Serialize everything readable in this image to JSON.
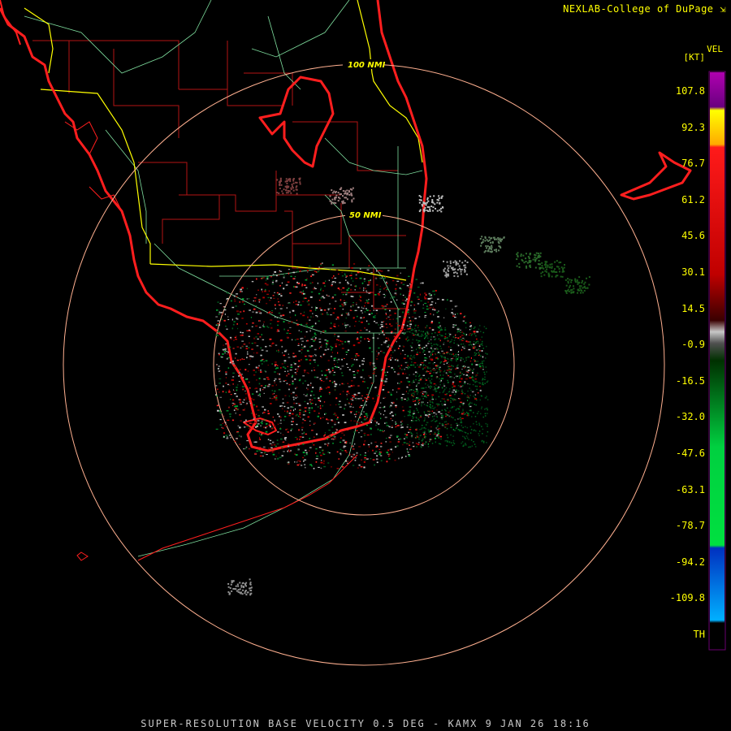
{
  "header": {
    "credit": "NEXLAB-College of DuPage",
    "credit_icon": "arrow-corner-icon"
  },
  "footer": {
    "caption": "SUPER-RESOLUTION BASE VELOCITY 0.5 DEG - KAMX 9 JAN 26 18:16"
  },
  "rings": [
    {
      "label": "50 NMI"
    },
    {
      "label": "100 NMI"
    }
  ],
  "legend": {
    "product": "VEL",
    "unit": "[KT]",
    "labels": [
      "107.8",
      "92.3",
      "76.7",
      "61.2",
      "45.6",
      "30.1",
      "14.5",
      "-0.9",
      "-16.5",
      "-32.0",
      "-47.6",
      "-63.1",
      "-78.7",
      "-94.2",
      "-109.8",
      "TH"
    ],
    "colors": {
      "purple": "#8b008b",
      "yellow": "#ffff00",
      "red": "#ff0000",
      "dark_red": "#5a0000",
      "gray": "#c8c8c8",
      "dark_green": "#006400",
      "green": "#00e040",
      "blue": "#0050ff",
      "cyan": "#00b0ff"
    }
  },
  "map_colors": {
    "coastline": "#ff1e1e",
    "state_lines": "#ffff00",
    "county_lines": "#b41414",
    "roads": "#7fdf9f",
    "range_rings": "#ffb090"
  }
}
